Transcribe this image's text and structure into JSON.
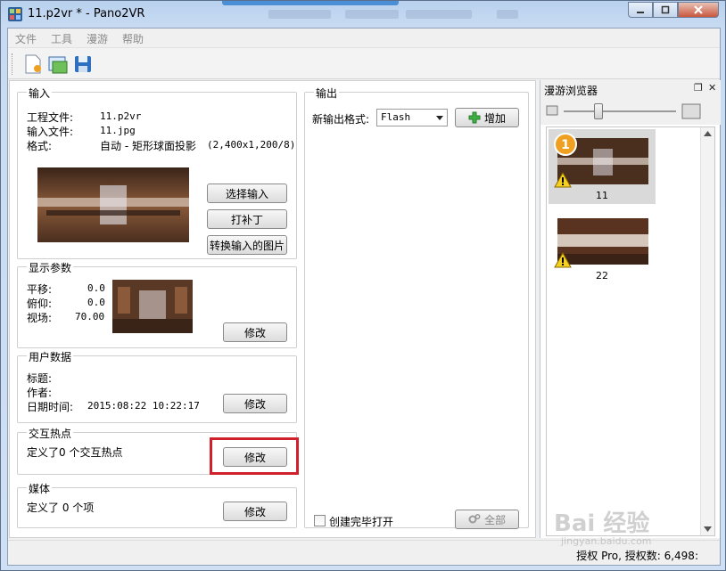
{
  "window": {
    "title": "11.p2vr * - Pano2VR"
  },
  "menu": [
    "文件",
    "工具",
    "漫游",
    "帮助"
  ],
  "toolbar": {
    "icons": [
      "new-project-icon",
      "open-project-icon",
      "save-icon"
    ]
  },
  "input": {
    "title": "输入",
    "project_label": "工程文件:",
    "project_value": "11.p2vr",
    "input_label": "输入文件:",
    "input_value": "11.jpg",
    "format_label": "格式:",
    "format_value": "自动 - 矩形球面投影",
    "format_size": "(2,400x1,200/8)",
    "btn_select": "选择输入",
    "btn_patch": "打补丁",
    "btn_convert": "转换输入的图片"
  },
  "display": {
    "title": "显示参数",
    "pan_label": "平移:",
    "pan_value": "0.0",
    "tilt_label": "俯仰:",
    "tilt_value": "0.0",
    "fov_label": "视场:",
    "fov_value": "70.00",
    "btn_modify": "修改"
  },
  "userdata": {
    "title": "用户数据",
    "title_label": "标题:",
    "author_label": "作者:",
    "date_label": "日期时间:",
    "date_value": "2015:08:22 10:22:17",
    "btn_modify": "修改"
  },
  "hotspots": {
    "title": "交互热点",
    "text": "定义了0 个交互热点",
    "btn_modify": "修改"
  },
  "media": {
    "title": "媒体",
    "text": "定义了 0 个项",
    "btn_modify": "修改"
  },
  "output": {
    "title": "输出",
    "format_label": "新输出格式:",
    "format_selected": "Flash",
    "btn_add": "增加",
    "open_checkbox_label": "创建完毕打开",
    "btn_all": "全部"
  },
  "tour": {
    "title": "漫游浏览器",
    "items": [
      {
        "label": "11",
        "badge": "1",
        "selected": true
      },
      {
        "label": "22",
        "badge": "",
        "selected": false
      }
    ]
  },
  "status": {
    "text": "授权 Pro, 授权数: 6,498:"
  },
  "watermark": {
    "text": "Bai 经验",
    "sub": "jingyan.baidu.com"
  },
  "colors": {
    "highlight": "#d0202a",
    "title_strip": "#4a8fd6",
    "badge": "#f0a020"
  }
}
